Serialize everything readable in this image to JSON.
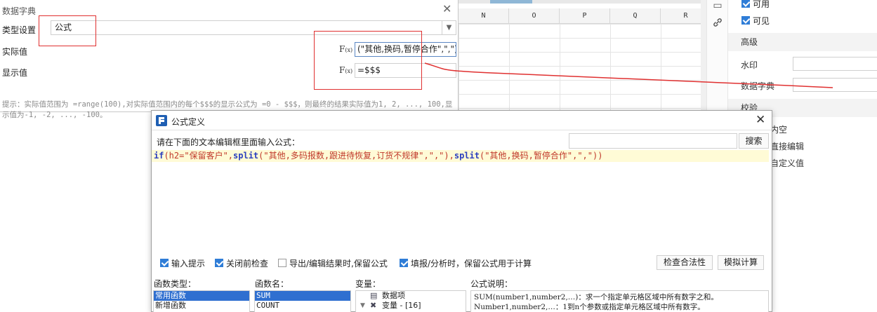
{
  "spreadsheet": {
    "columns": [
      "N",
      "O",
      "P",
      "Q",
      "R"
    ]
  },
  "properties_panel": {
    "checkbox_available": "可用",
    "checkbox_visible": "可见",
    "section_advanced": "高级",
    "watermark_label": "水印",
    "data_dictionary_label": "数据字典",
    "section_validation": "校验",
    "allow_empty_tail": "内空",
    "direct_edit_tail": "直接编辑",
    "custom_value_tail": "自定义值"
  },
  "data_dictionary_dialog": {
    "title": "数据字典",
    "type_label": "类型设置",
    "type_value": "公式",
    "actual_value_label": "实际值",
    "display_value_label": "显示值",
    "fx_symbol": "F",
    "fx_sub": "(x)",
    "actual_value_formula": "(\"其他,换码,暂停合作\",\",\"))",
    "display_value_formula": "=$$$",
    "hint": "提示：实际值范围为 =range(100),对实际值范围内的每个$$$的显示公式为 =0 - $$$，则最终的结果实际值为1, 2, ..., 100,显示值为-1, -2, ..., -100。"
  },
  "formula_dialog": {
    "title": "公式定义",
    "prompt": "请在下面的文本编辑框里面输入公式：",
    "search_button": "搜索",
    "formula_text": {
      "p1": "if",
      "p2": "(h2=\"保留客户\",",
      "p3": "split",
      "p4": "(\"其他,多码报数,跟进待恢复,订货不规律\",\",\"),",
      "p5": "split",
      "p6": "(\"其他,换码,暂停合作\",\",\"))"
    },
    "check_input_hint": "输入提示",
    "check_before_close": "关闭前检查",
    "check_export_keep": "导出/编辑结果时,保留公式",
    "check_fill_keep": "填报/分析时，保留公式用于计算",
    "btn_check_validity": "检查合法性",
    "btn_simulate": "模拟计算",
    "func_type_label": "函数类型：",
    "func_name_label": "函数名：",
    "variable_label": "变量：",
    "desc_label": "公式说明：",
    "func_types": [
      "常用函数",
      "新增函数"
    ],
    "func_names": [
      "SUM",
      "COUNT"
    ],
    "variables": {
      "item1": "数据项",
      "item2": "变量 - [16]"
    },
    "desc_line1": "SUM(number1,number2,…)：求一个指定单元格区域中所有数字之和。",
    "desc_line2": "Number1,number2,…：1到n个参数或指定单元格区域中所有数字。"
  },
  "colors": {
    "annotation_red": "#e03030",
    "selection_blue": "#2f6fd0",
    "formula_keyword": "#2b3fbf",
    "formula_string": "#c0392b"
  }
}
